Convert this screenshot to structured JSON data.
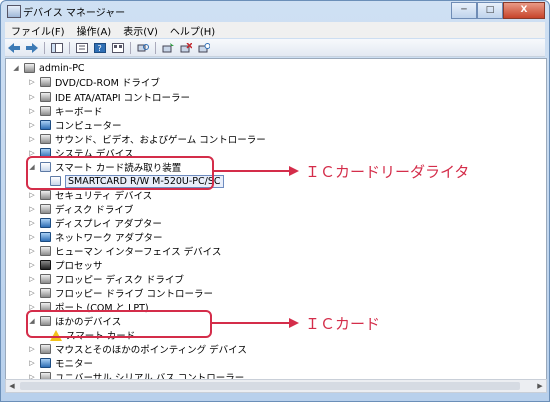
{
  "window": {
    "title": "デバイス マネージャー",
    "buttons": {
      "minimize": "─",
      "maximize": "□",
      "close": "X"
    }
  },
  "menu": [
    "ファイル(F)",
    "操作(A)",
    "表示(V)",
    "ヘルプ(H)"
  ],
  "toolbar": {
    "icons": [
      "back-icon",
      "forward-icon",
      "console-tree-icon",
      "properties-icon",
      "help-icon",
      "view-icon",
      "scan-hardware-icon",
      "update-driver-icon",
      "uninstall-icon",
      "disable-icon"
    ]
  },
  "tree": {
    "root": "admin-PC",
    "items": [
      "DVD/CD-ROM ドライブ",
      "IDE ATA/ATAPI コントローラー",
      "キーボード",
      "コンピューター",
      "サウンド、ビデオ、およびゲーム コントローラー",
      "システム デバイス",
      "スマート カード読み取り装置",
      "SMARTCARD R/W M-520U-PC/SC",
      "セキュリティ デバイス",
      "ディスク ドライブ",
      "ディスプレイ アダプター",
      "ネットワーク アダプター",
      "ヒューマン インターフェイス デバイス",
      "プロセッサ",
      "フロッピー ディスク ドライブ",
      "フロッピー ドライブ コントローラー",
      "ポート (COM と LPT)",
      "ほかのデバイス",
      "スマート カード",
      "マウスとそのほかのポインティング デバイス",
      "モニター",
      "ユニバーサル シリアル バス コントローラー"
    ]
  },
  "annotations": {
    "reader": "ＩＣカードリーダライタ",
    "card": "ＩＣカード"
  },
  "colors": {
    "annotation": "#d42d4a",
    "frame": "#6b8fb8"
  }
}
